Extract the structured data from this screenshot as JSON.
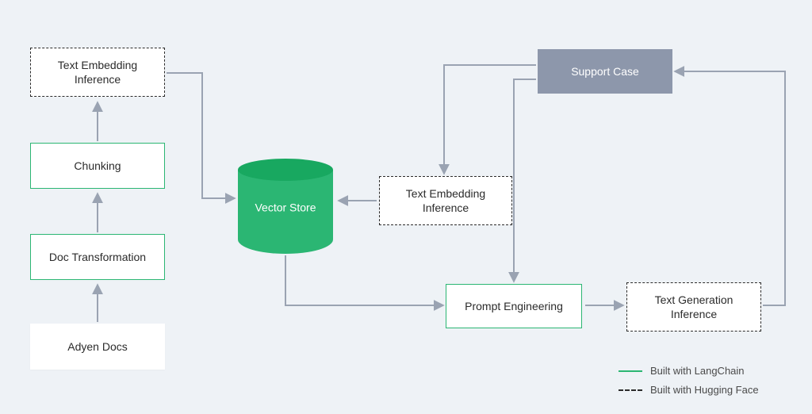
{
  "nodes": {
    "adyen_docs": "Adyen Docs",
    "doc_transformation": "Doc Transformation",
    "chunking": "Chunking",
    "tei_left": "Text Embedding\nInference",
    "vector_store": "Vector Store",
    "tei_mid": "Text Embedding\nInference",
    "support_case": "Support Case",
    "prompt_engineering": "Prompt Engineering",
    "text_generation": "Text Generation\nInference"
  },
  "legend": {
    "langchain": "Built with LangChain",
    "huggingface": "Built with Hugging Face"
  },
  "colors": {
    "green": "#2bb673",
    "support_bg": "#8d97ab",
    "arrow": "#9aa3b2",
    "bg": "#eef2f6"
  }
}
